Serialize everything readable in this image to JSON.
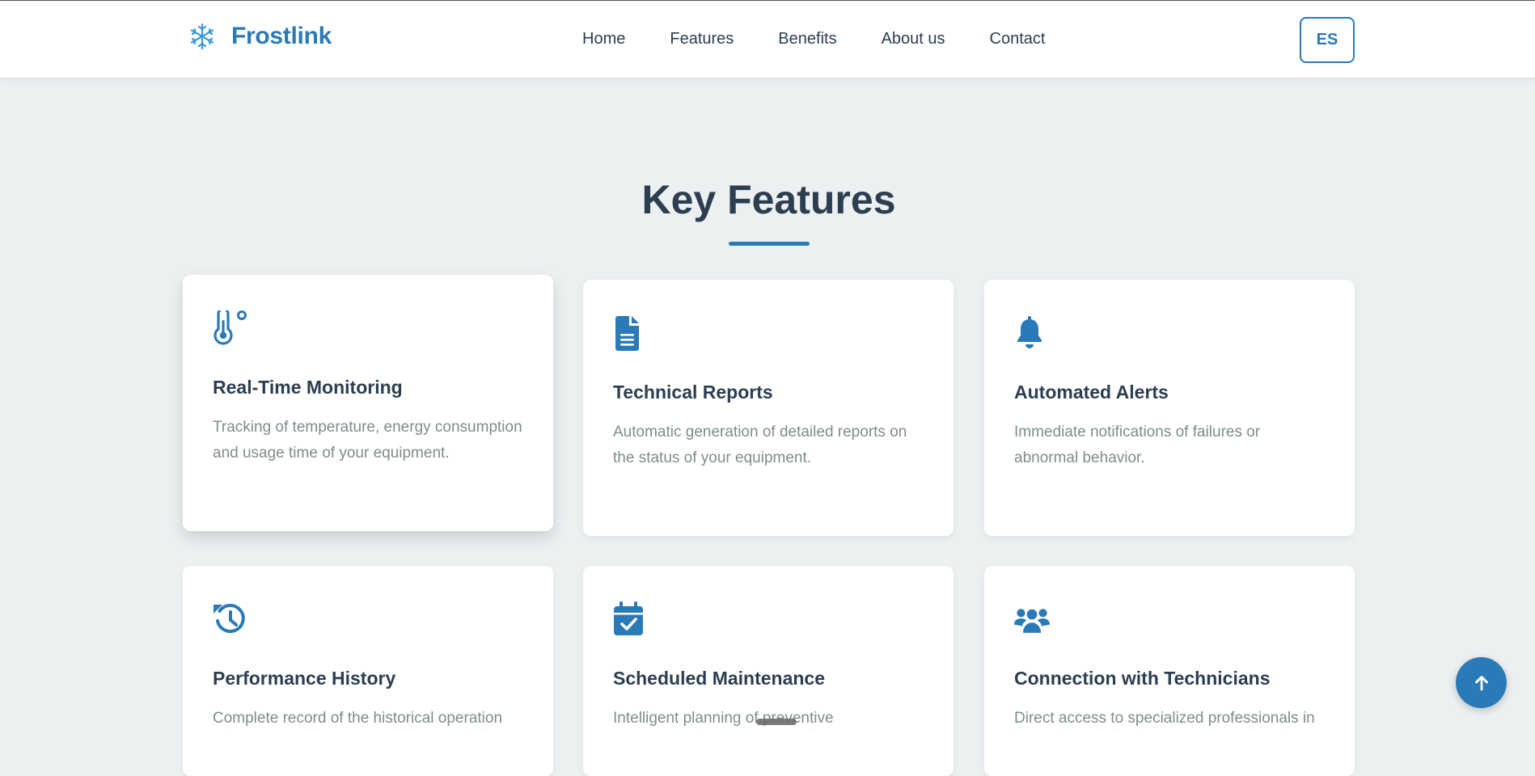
{
  "header": {
    "brand": "Frostlink",
    "brand_icon": "snowflake-icon",
    "nav": [
      {
        "label": "Home"
      },
      {
        "label": "Features"
      },
      {
        "label": "Benefits"
      },
      {
        "label": "About us"
      },
      {
        "label": "Contact"
      }
    ],
    "language_button": "ES"
  },
  "features": {
    "title": "Key Features",
    "cards": [
      {
        "icon": "thermometer-icon",
        "title": "Real-Time Monitoring",
        "description": "Tracking of temperature, energy consumption and usage time of your equipment."
      },
      {
        "icon": "file-icon",
        "title": "Technical Reports",
        "description": "Automatic generation of detailed reports on the status of your equipment."
      },
      {
        "icon": "bell-icon",
        "title": "Automated Alerts",
        "description": "Immediate notifications of failures or abnormal behavior."
      },
      {
        "icon": "history-icon",
        "title": "Performance History",
        "description": "Complete record of the historical operation"
      },
      {
        "icon": "calendar-check-icon",
        "title": "Scheduled Maintenance",
        "description": "Intelligent planning of preventive"
      },
      {
        "icon": "users-icon",
        "title": "Connection with Technicians",
        "description": "Direct access to specialized professionals in"
      }
    ]
  },
  "scroll_to_top_icon": "arrow-up-icon",
  "colors": {
    "accent": "#2a7ab8",
    "background": "#ecf0f1",
    "heading": "#2c3e50",
    "muted_text": "#7f8c8d"
  }
}
